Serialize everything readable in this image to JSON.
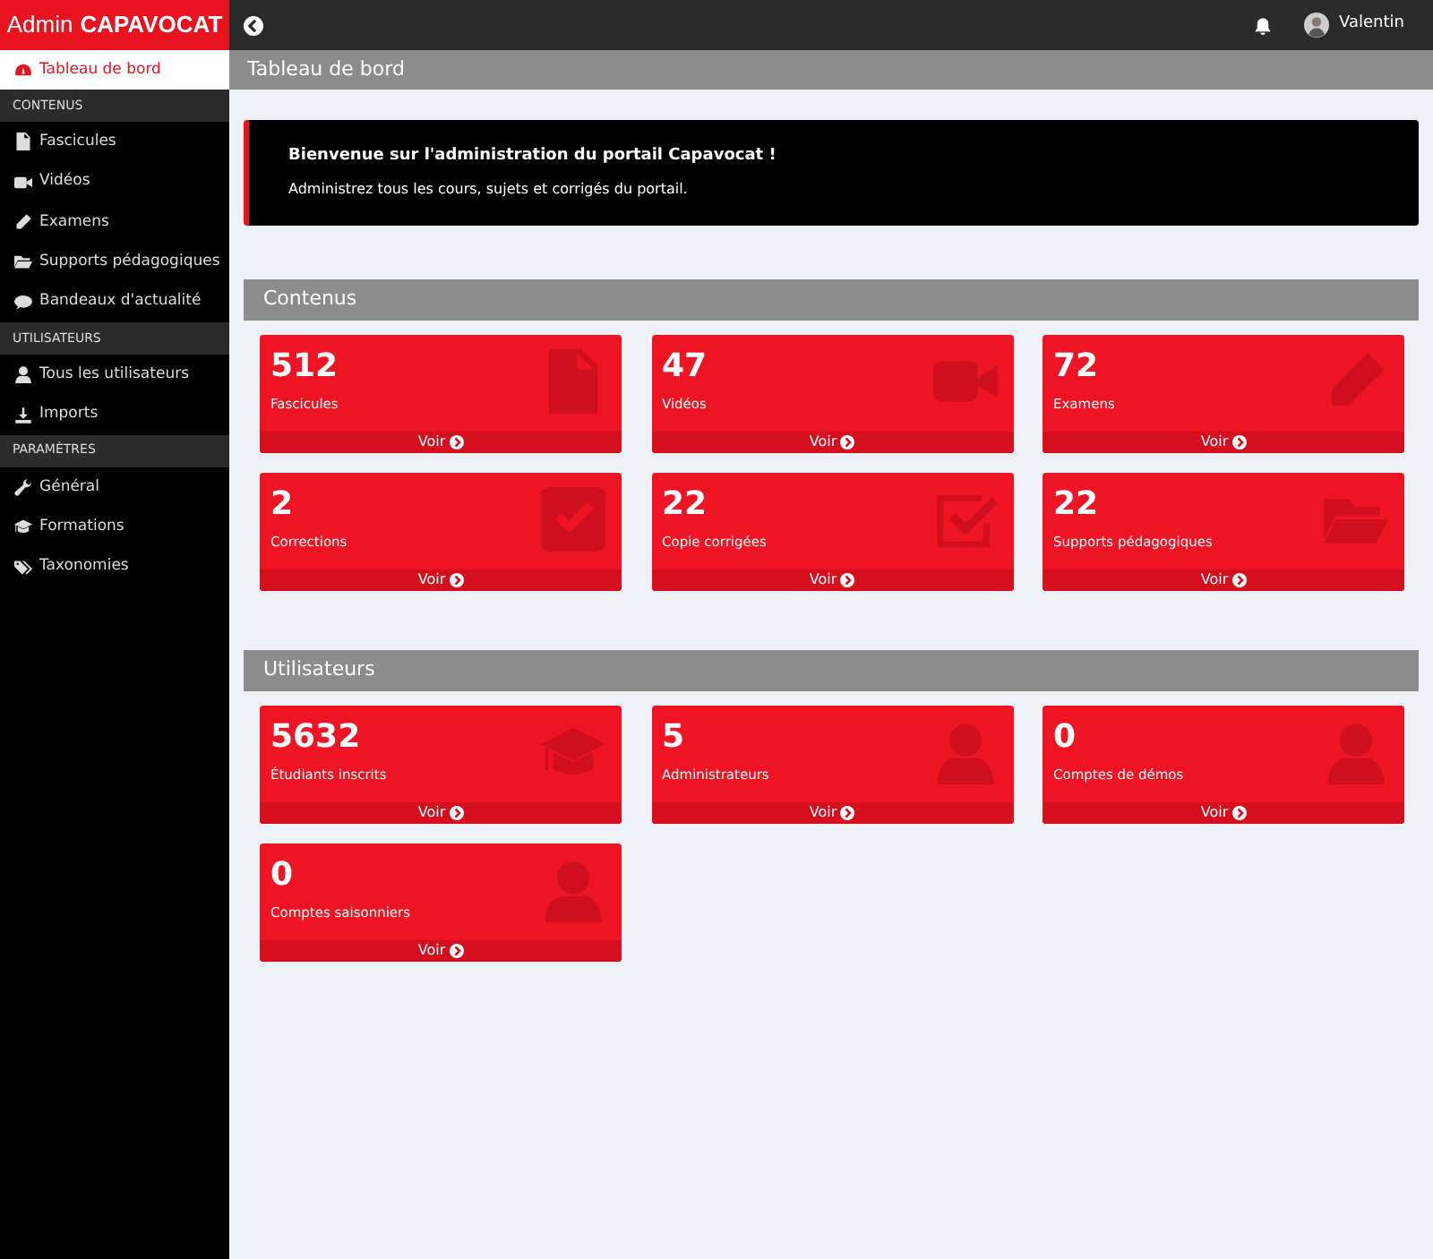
{
  "brand": {
    "light": "Admin",
    "bold": "CAPAVOCAT"
  },
  "sidebar": {
    "top_item": {
      "label": "Tableau de bord",
      "selected": true
    },
    "sections": [
      {
        "heading": "CONTENUS",
        "items": [
          {
            "label": "Fascicules",
            "selected": false
          },
          {
            "label": "Vidéos",
            "selected": false
          },
          {
            "label": "Examens",
            "selected": false
          },
          {
            "label": "Supports pédagogiques",
            "selected": false
          },
          {
            "label": "Bandeaux d'actualité",
            "selected": false
          }
        ]
      },
      {
        "heading": "UTILISATEURS",
        "items": [
          {
            "label": "Tous les utilisateurs",
            "selected": false
          },
          {
            "label": "Imports",
            "selected": false
          }
        ]
      },
      {
        "heading": "PARAMÈTRES",
        "items": [
          {
            "label": "Général",
            "selected": false
          },
          {
            "label": "Formations",
            "selected": false
          },
          {
            "label": "Taxonomies",
            "selected": false
          }
        ]
      }
    ]
  },
  "topbar": {
    "user": "Valentin"
  },
  "page_title": "Tableau de bord",
  "welcome": {
    "title": "Bienvenue sur l'administration du portail Capavocat !",
    "text": "Administrez tous les cours, sujets et corrigés du portail."
  },
  "panels": [
    {
      "title": "Contenus",
      "cards": [
        {
          "value": "512",
          "label": "Fascicules",
          "link": "Voir"
        },
        {
          "value": "47",
          "label": "Vidéos",
          "link": "Voir"
        },
        {
          "value": "72",
          "label": "Examens",
          "link": "Voir"
        },
        {
          "value": "2",
          "label": "Corrections",
          "link": "Voir"
        },
        {
          "value": "22",
          "label": "Copie corrigées",
          "link": "Voir"
        },
        {
          "value": "22",
          "label": "Supports pédagogiques",
          "link": "Voir"
        }
      ]
    },
    {
      "title": "Utilisateurs",
      "cards": [
        {
          "value": "5632",
          "label": "Étudiants inscrits",
          "link": "Voir"
        },
        {
          "value": "5",
          "label": "Administrateurs",
          "link": "Voir"
        },
        {
          "value": "0",
          "label": "Comptes de démos",
          "link": "Voir"
        },
        {
          "value": "0",
          "label": "Comptes saisonniers",
          "link": "Voir"
        }
      ]
    }
  ]
}
